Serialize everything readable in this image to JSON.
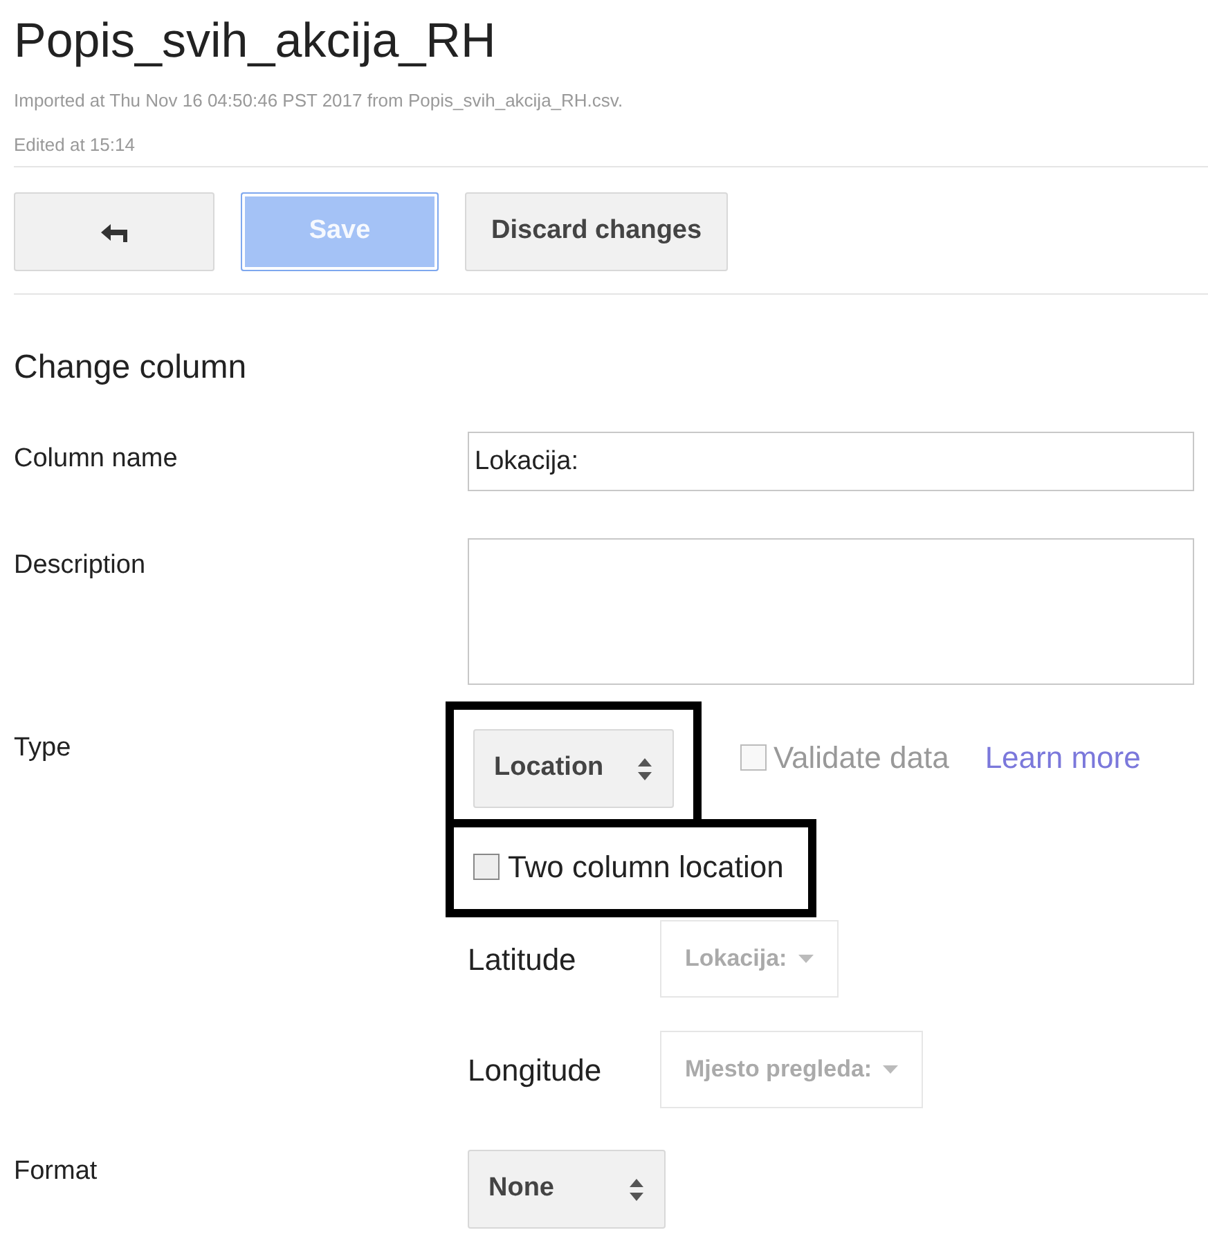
{
  "title": "Popis_svih_akcija_RH",
  "imported": "Imported at Thu Nov 16 04:50:46 PST 2017 from Popis_svih_akcija_RH.csv.",
  "edited": "Edited at 15:14",
  "toolbar": [
    {
      "kind": "back",
      "disabled": false
    },
    {
      "kind": "primary",
      "label": "Save",
      "disabled": true
    },
    {
      "kind": "text",
      "label": "Discard changes",
      "disabled": false
    }
  ],
  "heading": "Change column",
  "column_name": {
    "label": "Column name",
    "value": "Lokacija:"
  },
  "description": {
    "label": "Description"
  },
  "type": {
    "label": "Type",
    "value": "Location",
    "highlighted": true,
    "validate": {
      "label": "Validate data",
      "checked": false,
      "disabled": true
    },
    "learn_more": "Learn more"
  },
  "two_column": {
    "label": "Two column location",
    "checked": false,
    "highlighted": true
  },
  "coords": [
    {
      "label": "Latitude",
      "value": "Lokacija:",
      "disabled": true
    },
    {
      "label": "Longitude",
      "value": "Mjesto pregleda:",
      "disabled": true
    }
  ],
  "format": {
    "label": "Format",
    "value": "None"
  }
}
